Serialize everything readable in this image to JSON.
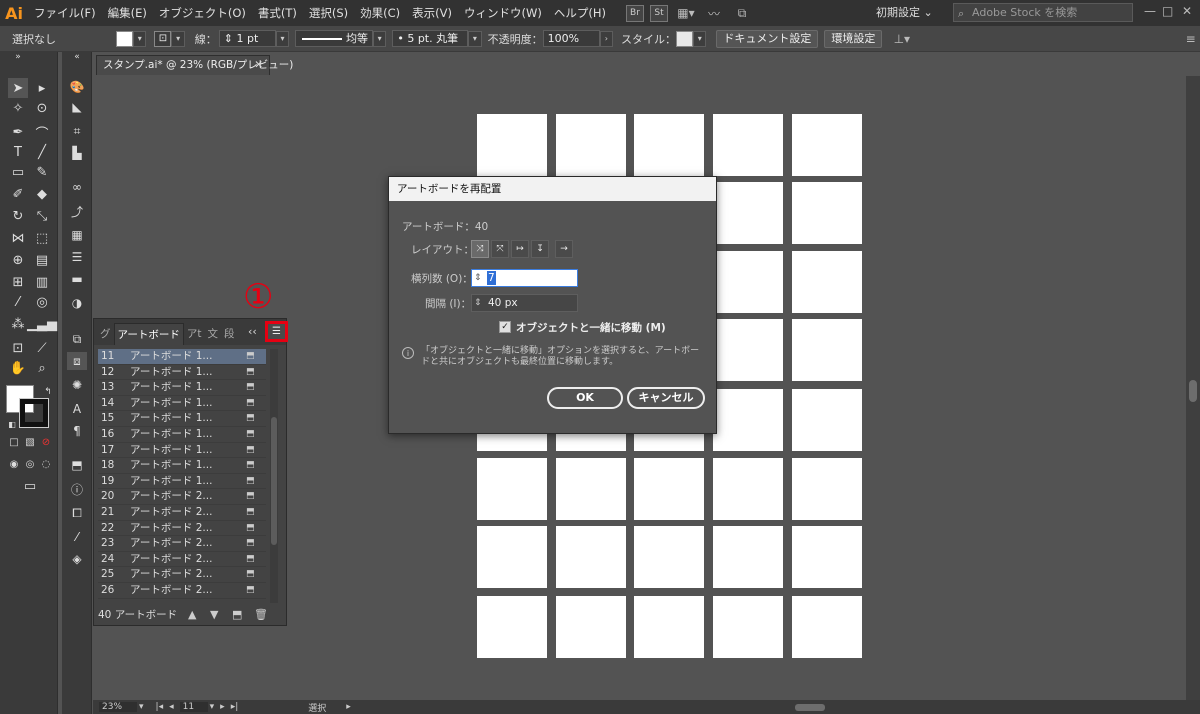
{
  "app": {
    "logo": "Ai"
  },
  "menu": [
    "ファイル(F)",
    "編集(E)",
    "オブジェクト(O)",
    "書式(T)",
    "選択(S)",
    "効果(C)",
    "表示(V)",
    "ウィンドウ(W)",
    "ヘルプ(H)"
  ],
  "menubar": {
    "bridge": "Br",
    "stock": "St",
    "workspace": "初期設定",
    "search_placeholder": "Adobe Stock を検索"
  },
  "controlbar": {
    "selection": "選択なし",
    "stroke_label": "線：",
    "stroke_weight": "1 pt",
    "stroke_profile": "均等",
    "brush": "5 pt. 丸筆",
    "opacity_label": "不透明度：",
    "opacity": "100%",
    "style_label": "スタイル：",
    "doc_setup": "ドキュメント設定",
    "preferences": "環境設定"
  },
  "document": {
    "tab_title": "スタンプ.ai* @ 23% (RGB/プレビュー)"
  },
  "artboard_panel": {
    "tabs": [
      "グ",
      "アートボード",
      "アt",
      "文",
      "段"
    ],
    "callout": "①",
    "rows": [
      {
        "num": "11",
        "name": "アートボード 1..."
      },
      {
        "num": "12",
        "name": "アートボード 1..."
      },
      {
        "num": "13",
        "name": "アートボード 1..."
      },
      {
        "num": "14",
        "name": "アートボード 1..."
      },
      {
        "num": "15",
        "name": "アートボード 1..."
      },
      {
        "num": "16",
        "name": "アートボード 1..."
      },
      {
        "num": "17",
        "name": "アートボード 1..."
      },
      {
        "num": "18",
        "name": "アートボード 1..."
      },
      {
        "num": "19",
        "name": "アートボード 1..."
      },
      {
        "num": "20",
        "name": "アートボード 2..."
      },
      {
        "num": "21",
        "name": "アートボード 2..."
      },
      {
        "num": "22",
        "name": "アートボード 2..."
      },
      {
        "num": "23",
        "name": "アートボード 2..."
      },
      {
        "num": "24",
        "name": "アートボード 2..."
      },
      {
        "num": "25",
        "name": "アートボード 2..."
      },
      {
        "num": "26",
        "name": "アートボード 2..."
      }
    ],
    "footer": "40 アートボード"
  },
  "dialog": {
    "title": "アートボードを再配置",
    "count_label": "アートボード：40",
    "layout_label": "レイアウト：",
    "rows_label": "横列数 (O)：",
    "rows_value": "7",
    "spacing_label": "間隔 (I)：",
    "spacing_value": "40 px",
    "move_label": "オブジェクトと一緒に移動 (M)",
    "info_line1": "「オブジェクトと一緒に移動」オプションを選択すると、アートボー",
    "info_line2": "ドと共にオブジェクトも最終位置に移動します。",
    "ok": "OK",
    "cancel": "キャンセル"
  },
  "statusbar": {
    "zoom": "23%",
    "page": "11",
    "mode": "選択"
  },
  "colors": {
    "highlight": "#e60012",
    "selection": "#5f6f86"
  }
}
